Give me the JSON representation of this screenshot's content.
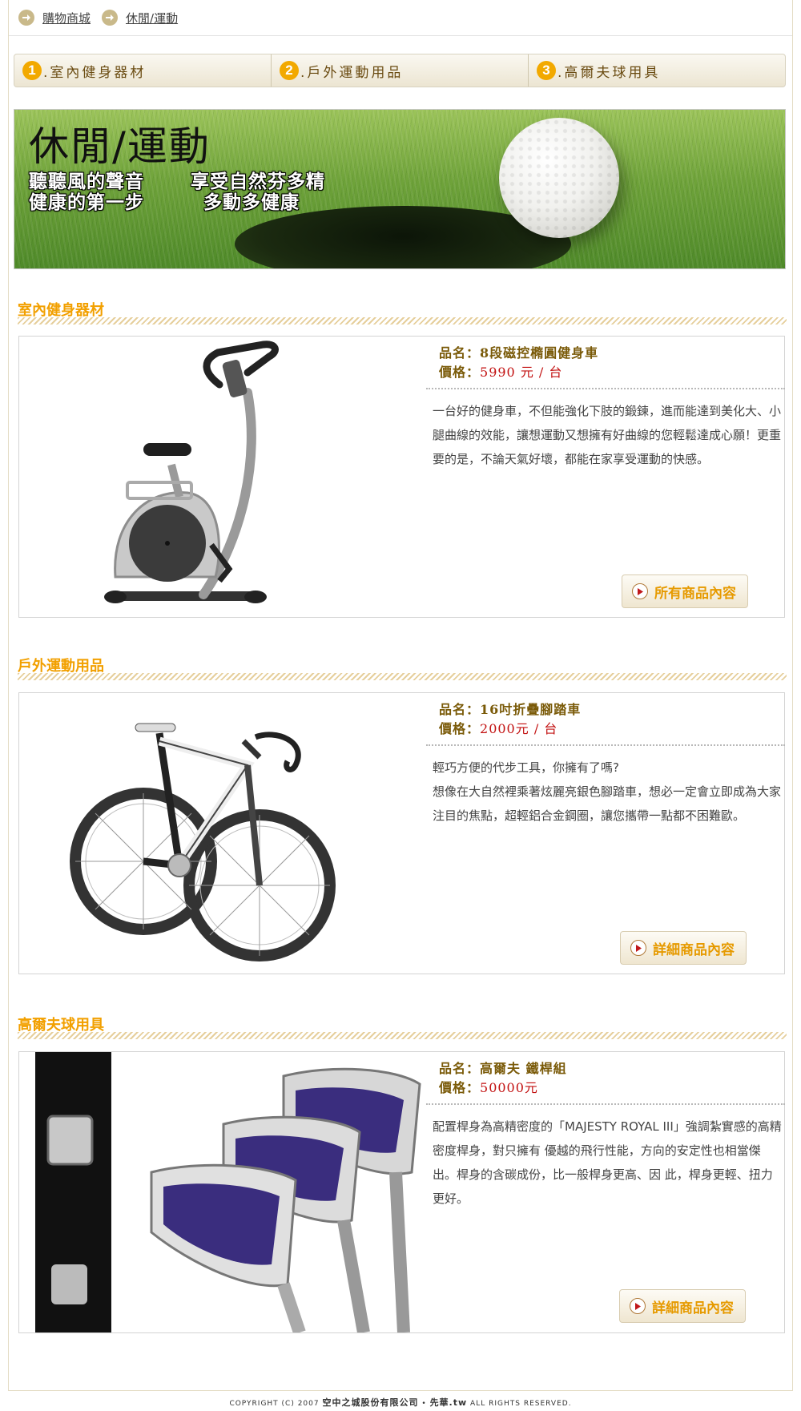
{
  "breadcrumb": {
    "items": [
      {
        "label": "購物商城",
        "icon": "arrow-right-circle-icon"
      },
      {
        "label": "休閒/運動",
        "icon": "arrow-right-circle-icon"
      }
    ]
  },
  "categories": [
    {
      "num": "1",
      "label": "室內健身器材"
    },
    {
      "num": "2",
      "label": "戶外運動用品"
    },
    {
      "num": "3",
      "label": "高爾夫球用具"
    }
  ],
  "hero": {
    "title": "休閒/運動",
    "line1_left": "聽聽風的聲音",
    "line1_right": "享受自然芬多精",
    "line2_left": "健康的第一步",
    "line2_right": "多動多健康"
  },
  "sections": [
    {
      "title": "室內健身器材",
      "name": "品名：8段磁控橢圓健身車",
      "price_label": "價格：",
      "price_value": "5990 元 / 台",
      "desc": "一台好的健身車，不但能強化下肢的鍛鍊，進而能達到美化大、小腿曲線的效能，讓想運動又想擁有好曲線的您輕鬆達成心願！更重要的是，不論天氣好壞，都能在家享受運動的快感。",
      "button": "所有商品內容"
    },
    {
      "title": "戶外運動用品",
      "name": "品名：16吋折疊腳踏車",
      "price_label": "價格：",
      "price_value": "2000元 / 台",
      "desc_line1": "輕巧方便的代步工具，你擁有了嗎?",
      "desc": "想像在大自然裡乘著炫麗亮銀色腳踏車，想必一定會立即成為大家注目的焦點，超輕鋁合金鋼圈，讓您攜帶一點都不困難歐。",
      "button": "詳細商品內容"
    },
    {
      "title": "高爾夫球用具",
      "name": "品名：高爾夫 鐵桿組",
      "price_label": "價格：",
      "price_value": "50000元",
      "desc": "配置桿身為高精密度的「MAJESTY ROYAL III」強調紮實感的高精密度桿身，對只擁有 優越的飛行性能，方向的安定性也相當傑出。桿身的含碳成份，比一般桿身更高、因 此，桿身更輕、扭力更好。",
      "button": "詳細商品內容"
    }
  ],
  "footer": {
    "prefix": "COPYRIGHT (C) 2007",
    "company": "空中之城股份有限公司",
    "sep": "•",
    "site": "先華.tw",
    "suffix": "ALL RIGHTS RESERVED."
  },
  "colors": {
    "accent": "#f2a000",
    "price": "#c21010",
    "label": "#7a5a08"
  }
}
